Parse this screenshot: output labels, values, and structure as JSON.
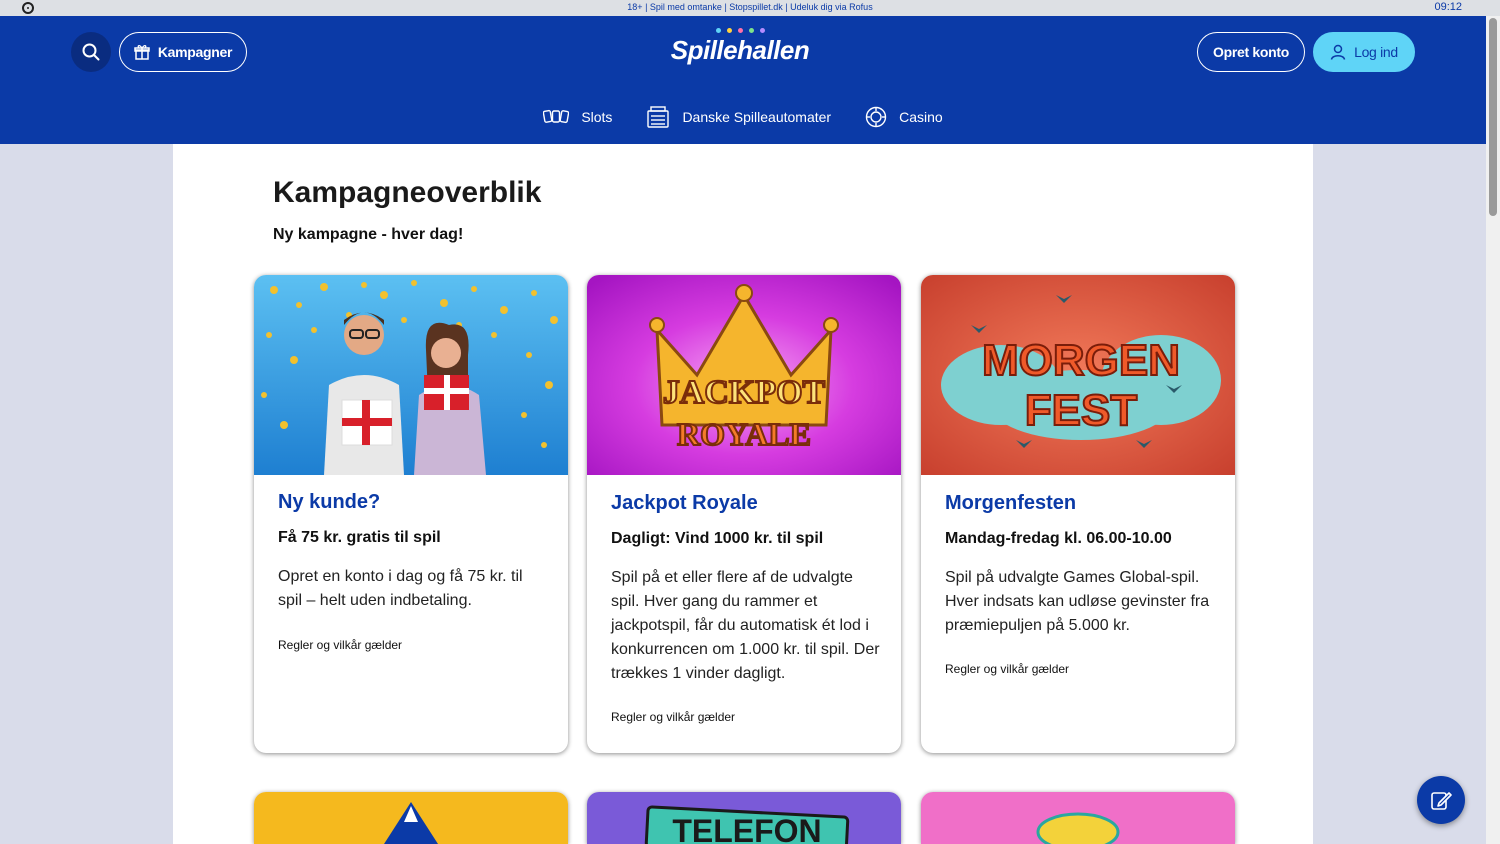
{
  "topbar": {
    "notice": "18+ | Spil med omtanke | Stopspillet.dk | Udeluk dig via Rofus",
    "time": "09:12"
  },
  "header": {
    "logo_text": "Spillehallen",
    "campaigns_label": "Kampagner",
    "create_account_label": "Opret konto",
    "login_label": "Log ind",
    "brand_color": "#0b3aa7",
    "login_color": "#5fd4f7"
  },
  "nav": {
    "items": [
      {
        "label": "Slots",
        "icon": "slot-machine-icon"
      },
      {
        "label": "Danske Spilleautomater",
        "icon": "cabinet-icon"
      },
      {
        "label": "Casino",
        "icon": "casino-chip-icon"
      }
    ]
  },
  "page": {
    "title": "Kampagneoverblik",
    "subtitle": "Ny kampagne - hver dag!"
  },
  "cards": [
    {
      "title": "Ny kunde?",
      "subtitle": "Få 75 kr. gratis til spil",
      "description": "Opret en konto i dag og få 75 kr. til spil – helt uden indbetaling.",
      "terms": "Regler og vilkår gælder"
    },
    {
      "title": "Jackpot Royale",
      "subtitle": "Dagligt: Vind 1000 kr. til spil",
      "description": "Spil på et eller flere af de udvalgte spil. Hver gang du rammer et jackpotspil, får du automatisk ét lod i konkurrencen om 1.000 kr. til spil. Der trækkes 1 vinder dagligt.",
      "terms": "Regler og vilkår gælder",
      "image_text_1": "JACKPOT",
      "image_text_2": "ROYALE"
    },
    {
      "title": "Morgenfesten",
      "subtitle": "Mandag-fredag kl. 06.00-10.00",
      "description": "Spil på udvalgte Games Global-spil. Hver indsats kan udløse gevinster fra præmiepuljen på 5.000 kr.",
      "terms": "Regler og vilkår gælder",
      "image_text_1": "MORGEN",
      "image_text_2": "FEST"
    }
  ],
  "bottom_cards": [
    {
      "image_text": ""
    },
    {
      "image_text": "TELEFON"
    },
    {
      "image_text": ""
    }
  ]
}
